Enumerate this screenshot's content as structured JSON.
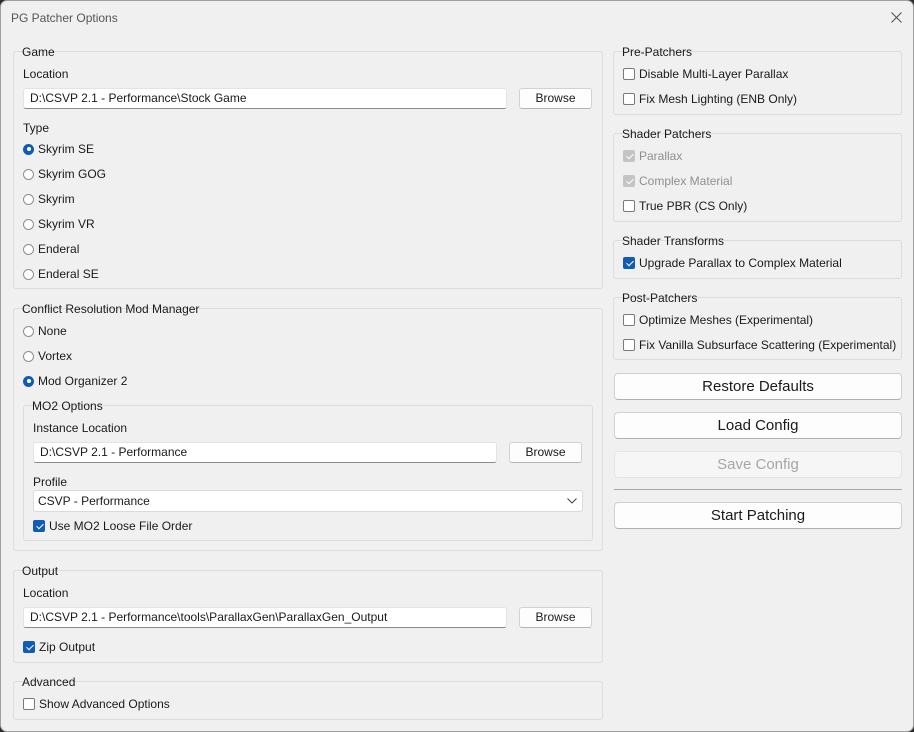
{
  "window": {
    "title": "PG Patcher Options"
  },
  "game": {
    "legend": "Game",
    "location_label": "Location",
    "location_value": "D:\\CSVP 2.1 - Performance\\Stock Game",
    "browse_label": "Browse",
    "type_label": "Type",
    "types": [
      {
        "label": "Skyrim SE",
        "selected": true
      },
      {
        "label": "Skyrim GOG",
        "selected": false
      },
      {
        "label": "Skyrim",
        "selected": false
      },
      {
        "label": "Skyrim VR",
        "selected": false
      },
      {
        "label": "Enderal",
        "selected": false
      },
      {
        "label": "Enderal SE",
        "selected": false
      }
    ]
  },
  "mod_manager": {
    "legend": "Conflict Resolution Mod Manager",
    "options": [
      {
        "label": "None",
        "selected": false
      },
      {
        "label": "Vortex",
        "selected": false
      },
      {
        "label": "Mod Organizer 2",
        "selected": true
      }
    ],
    "mo2": {
      "legend": "MO2 Options",
      "instance_label": "Instance Location",
      "instance_value": "D:\\CSVP 2.1 - Performance",
      "browse_label": "Browse",
      "profile_label": "Profile",
      "profile_value": "CSVP - Performance",
      "loose_order_label": "Use MO2 Loose File Order",
      "loose_order_checked": true
    }
  },
  "output": {
    "legend": "Output",
    "location_label": "Location",
    "location_value": "D:\\CSVP 2.1 - Performance\\tools\\ParallaxGen\\ParallaxGen_Output",
    "browse_label": "Browse",
    "zip_label": "Zip Output",
    "zip_checked": true
  },
  "advanced": {
    "legend": "Advanced",
    "show_label": "Show Advanced Options",
    "show_checked": false
  },
  "pre_patchers": {
    "legend": "Pre-Patchers",
    "items": [
      {
        "label": "Disable Multi-Layer Parallax",
        "checked": false
      },
      {
        "label": "Fix Mesh Lighting (ENB Only)",
        "checked": false
      }
    ]
  },
  "shader_patchers": {
    "legend": "Shader Patchers",
    "items": [
      {
        "label": "Parallax",
        "checked": true,
        "disabled": true
      },
      {
        "label": "Complex Material",
        "checked": true,
        "disabled": true
      },
      {
        "label": "True PBR (CS Only)",
        "checked": false,
        "disabled": false
      }
    ]
  },
  "shader_transforms": {
    "legend": "Shader Transforms",
    "items": [
      {
        "label": "Upgrade Parallax to Complex Material",
        "checked": true
      }
    ]
  },
  "post_patchers": {
    "legend": "Post-Patchers",
    "items": [
      {
        "label": "Optimize Meshes (Experimental)",
        "checked": false
      },
      {
        "label": "Fix Vanilla Subsurface Scattering (Experimental)",
        "checked": false
      }
    ]
  },
  "actions": {
    "restore_defaults": "Restore Defaults",
    "load_config": "Load Config",
    "save_config": "Save Config",
    "start_patching": "Start Patching"
  },
  "colors": {
    "accent": "#0f5bb5",
    "window_bg": "#f0f0f0"
  }
}
